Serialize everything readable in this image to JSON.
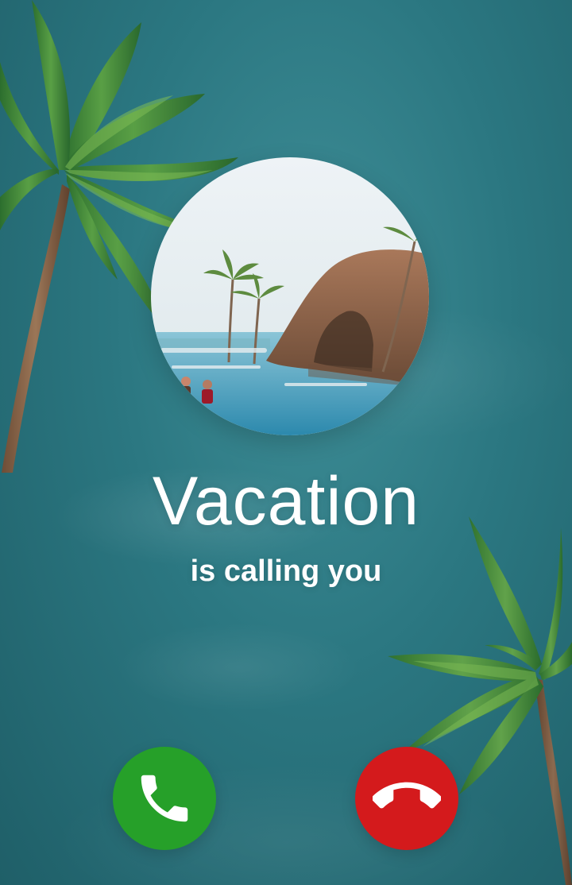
{
  "caller": {
    "name": "Vacation",
    "subtitle": "is calling you"
  },
  "actions": {
    "accept_icon": "phone-accept-icon",
    "decline_icon": "phone-decline-icon"
  },
  "colors": {
    "background": "#2b7781",
    "accept": "#26a029",
    "decline": "#d41a1c",
    "text": "#ffffff"
  },
  "avatar": {
    "image": "tropical-pool-resort-photo"
  }
}
